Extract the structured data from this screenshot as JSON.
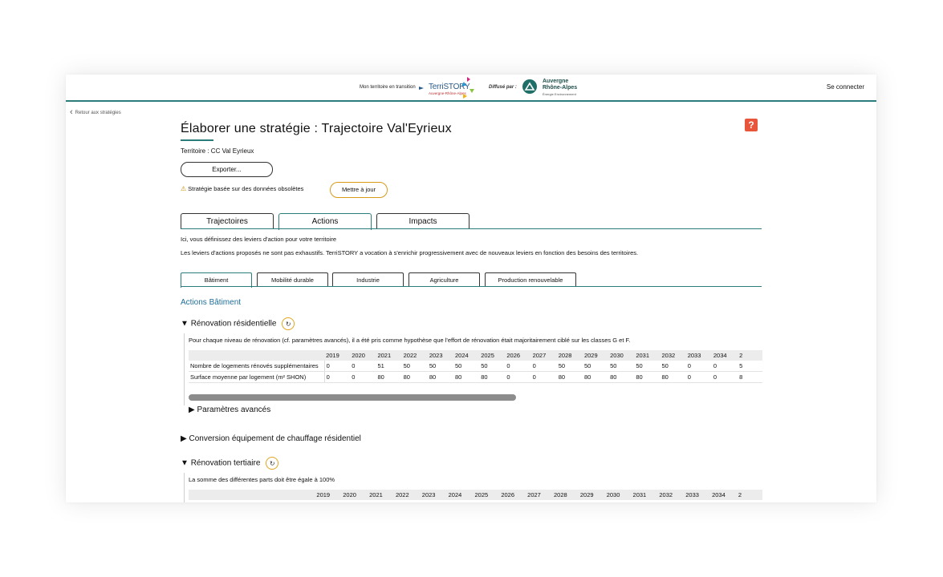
{
  "header": {
    "tagline": "Mon territoire en transition",
    "logo_text": "TerriSTORY",
    "logo_sub": "Auvergne-Rhône-Alpes",
    "diffuse_label": "Diffusé par :",
    "partner_name_1": "Auvergne",
    "partner_name_2": "Rhône-Alpes",
    "partner_sub": "Énergie Environnement",
    "login": "Se connecter",
    "accent_color": "#2a7d7b"
  },
  "nav": {
    "back": "Retour aux stratégies"
  },
  "page": {
    "title": "Élaborer une stratégie : Trajectoire Val'Eyrieux",
    "help": "?",
    "territory": "Territoire : CC Val Eyrieux",
    "export": "Exporter...",
    "obsolete": "Stratégie basée sur des données obsolètes",
    "update": "Mettre à jour"
  },
  "tabs": [
    {
      "label": "Trajectoires"
    },
    {
      "label": "Actions"
    },
    {
      "label": "Impacts"
    }
  ],
  "intro": {
    "line1": "Ici, vous définissez des leviers d'action pour votre territoire",
    "line2": "Les leviers d'actions proposés ne sont pas exhaustifs. TerriSTORY a vocation à s'enrichir progressivement avec de nouveaux leviers en fonction des besoins des territoires."
  },
  "subtabs": [
    {
      "label": "Bâtiment"
    },
    {
      "label": "Mobilité durable"
    },
    {
      "label": "Industrie"
    },
    {
      "label": "Agriculture"
    },
    {
      "label": "Production renouvelable"
    }
  ],
  "section": {
    "title": "Actions Bâtiment",
    "renovation_res": {
      "label": "Rénovation résidentielle",
      "note": "Pour chaque niveau de rénovation (cf. paramètres avancés), il a été pris comme hypothèse que l'effort de rénovation était majoritairement ciblé sur les classes G et F.",
      "advanced": "Paramètres avancés"
    },
    "conversion": {
      "label": "Conversion équipement de chauffage résidentiel"
    },
    "renovation_ter": {
      "label": "Rénovation tertiaire",
      "note": "La somme des différentes parts doit être égale à 100%"
    }
  },
  "table_res": {
    "years": [
      "2019",
      "2020",
      "2021",
      "2022",
      "2023",
      "2024",
      "2025",
      "2026",
      "2027",
      "2028",
      "2029",
      "2030",
      "2031",
      "2032",
      "2033",
      "2034",
      "2"
    ],
    "rows": [
      {
        "label": "Nombre de logements rénovés supplémentaires",
        "values": [
          "0",
          "0",
          "51",
          "50",
          "50",
          "50",
          "50",
          "0",
          "0",
          "50",
          "50",
          "50",
          "50",
          "50",
          "0",
          "0",
          "5"
        ]
      },
      {
        "label": "Surface moyenne par logement (m² SHON)",
        "values": [
          "0",
          "0",
          "80",
          "80",
          "80",
          "80",
          "80",
          "0",
          "0",
          "80",
          "80",
          "80",
          "80",
          "80",
          "0",
          "0",
          "8"
        ]
      }
    ]
  },
  "table_ter": {
    "years": [
      "2019",
      "2020",
      "2021",
      "2022",
      "2023",
      "2024",
      "2025",
      "2026",
      "2027",
      "2028",
      "2029",
      "2030",
      "2031",
      "2032",
      "2033",
      "2034",
      "2"
    ]
  }
}
